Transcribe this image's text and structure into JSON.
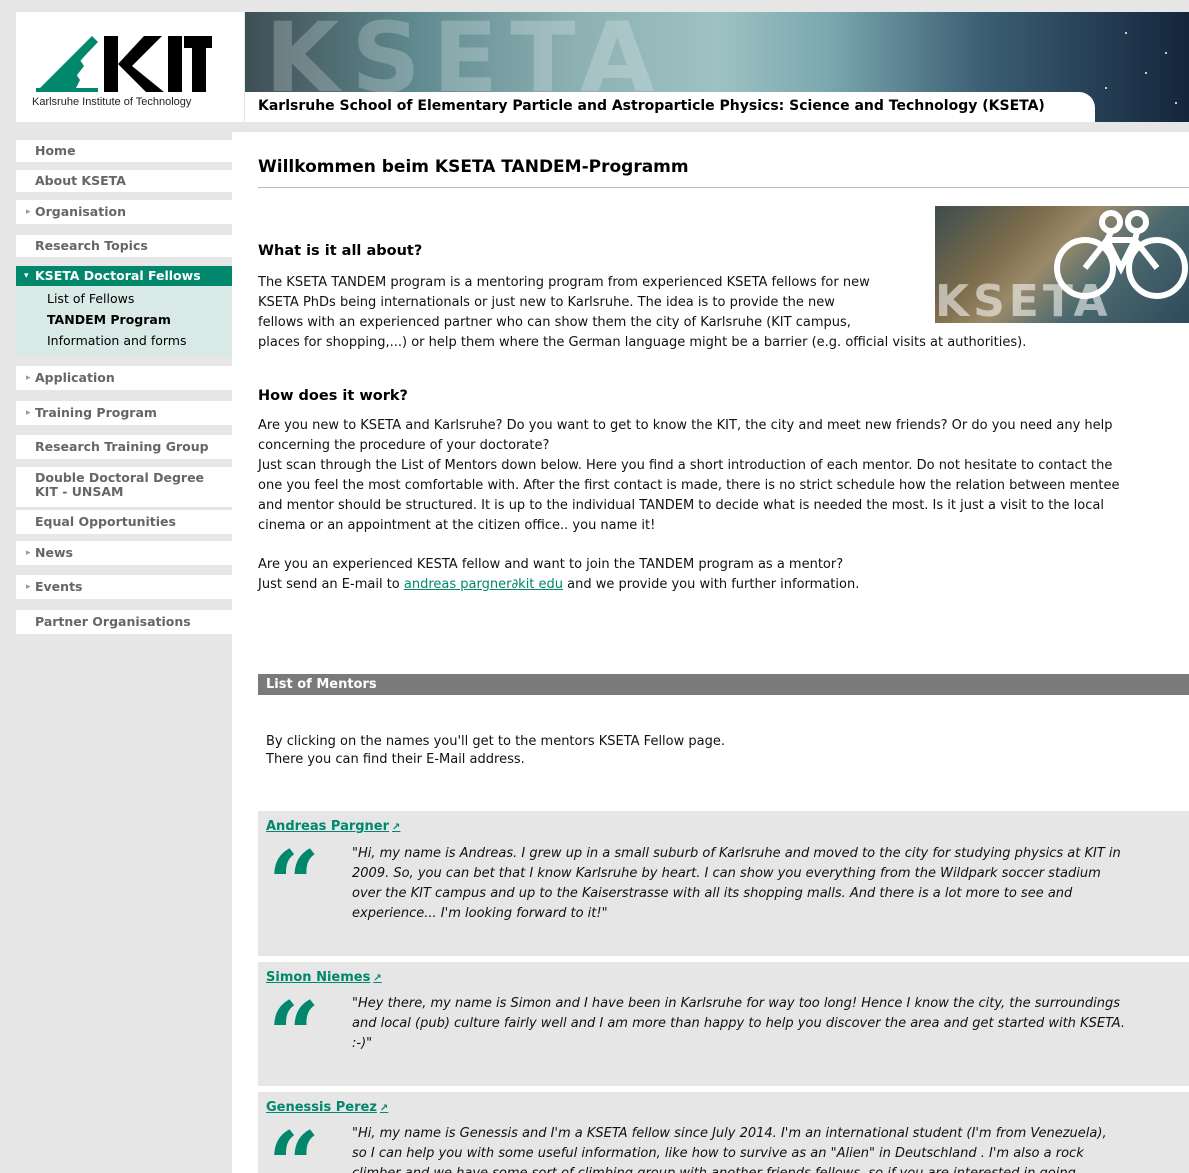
{
  "header": {
    "logo_text": "KIT",
    "logo_subtitle": "Karlsruhe Institute of Technology",
    "banner_watermark": "KSETA",
    "site_title": "Karlsruhe School of Elementary Particle and Astroparticle Physics: Science and Technology (KSETA)"
  },
  "sidebar": {
    "items": [
      {
        "label": "Home",
        "arrow": ""
      },
      {
        "label": "About KSETA",
        "arrow": ""
      },
      {
        "label": "Organisation",
        "arrow": "▸"
      },
      {
        "label": "Research Topics",
        "arrow": ""
      },
      {
        "label": "KSETA Doctoral Fellows",
        "arrow": "▾"
      },
      {
        "label": "Application",
        "arrow": "▸"
      },
      {
        "label": "Training Program",
        "arrow": "▸"
      },
      {
        "label": "Research Training Group",
        "arrow": ""
      },
      {
        "label": "Double Doctoral Degree",
        "label2": "KIT - UNSAM",
        "arrow": ""
      },
      {
        "label": "Equal Opportunities",
        "arrow": ""
      },
      {
        "label": "News",
        "arrow": "▸"
      },
      {
        "label": "Events",
        "arrow": "▸"
      },
      {
        "label": "Partner Organisations",
        "arrow": ""
      }
    ],
    "subitems": [
      {
        "label": "List of Fellows"
      },
      {
        "label": "TANDEM Program"
      },
      {
        "label": "Information and forms"
      }
    ]
  },
  "main": {
    "title": "Willkommen beim KSETA TANDEM-Programm",
    "image_watermark": "KSETA",
    "section1_heading": "What is it all about?",
    "section1_lines": [
      "The KSETA TANDEM program is a mentoring program from experienced KSETA fellows for new",
      "KSETA PhDs being internationals or just new to Karlsruhe. The idea is to provide the new",
      "fellows with an experienced partner who can show them the city of Karlsruhe (KIT campus,",
      "places for shopping,...) or help them where the German language might be a barrier (e.g. official visits at authorities)."
    ],
    "section2_heading": "How does it work?",
    "section2_lines": [
      "Are you new to KSETA and Karlsruhe? Do you want to get to know the KIT, the city and meet new friends? Or do you need any help",
      "concerning the procedure of your doctorate?",
      "Just scan through the List of Mentors down below. Here you find a short introduction of each mentor. Do not hesitate to contact the",
      "one you feel the most comfortable with. After the first contact is made, there is no strict schedule how the relation between mentee",
      "and mentor should be structured. It is up to the individual TANDEM to decide what is needed the most. Is it just a visit to the local",
      "cinema or an appointment at the citizen office.. you name it!"
    ],
    "join_line1": "Are you an experienced KESTA fellow and want to join the TANDEM program as a mentor?",
    "join_line2_prefix": "Just send an E-mail to ",
    "join_email": "andreas pargner∂kit edu",
    "join_line2_suffix": " and we provide you with further information.",
    "mentors_heading": "List of Mentors",
    "mentors_intro_1": "By clicking on the names you'll get to the mentors KSETA Fellow page.",
    "mentors_intro_2": "There you can find their E-Mail address.",
    "quote_glyph": "“",
    "ext_icon_glyph": "↗",
    "mentors": [
      {
        "name": "Andreas Pargner",
        "lines": [
          "\"Hi, my name is Andreas. I grew up in a small suburb of Karlsruhe and moved to the city for studying physics at KIT in",
          "2009. So, you can bet that I know Karlsruhe by heart. I can show you everything from the Wildpark soccer stadium",
          "over the KIT campus and up to the Kaiserstrasse with all its shopping malls. And there is a lot more to see and",
          "experience... I'm looking forward to it!\""
        ]
      },
      {
        "name": "Simon Niemes",
        "lines": [
          "\"Hey there, my name is Simon and I have been in Karlsruhe for way too long! Hence I know the city, the surroundings",
          "and local (pub) culture fairly well and I am more than happy to help you discover the area and get started with KSETA.",
          ":-)\""
        ]
      },
      {
        "name": "Genessis Perez",
        "lines": [
          "\"Hi, my name is Genessis and I'm a KSETA fellow since July 2014. I'm an international student (I'm from Venezuela),",
          "so I can help you with some useful information, like how to survive as an \"Alien\" in Deutschland . I'm also a rock",
          "climber and we have some sort of climbing group with another friends fellows, so if you are interested in going"
        ]
      }
    ]
  },
  "colors": {
    "accent": "#00876c",
    "sidebar_bg": "#e6e6e6",
    "section_bar": "#7a7a7a"
  }
}
